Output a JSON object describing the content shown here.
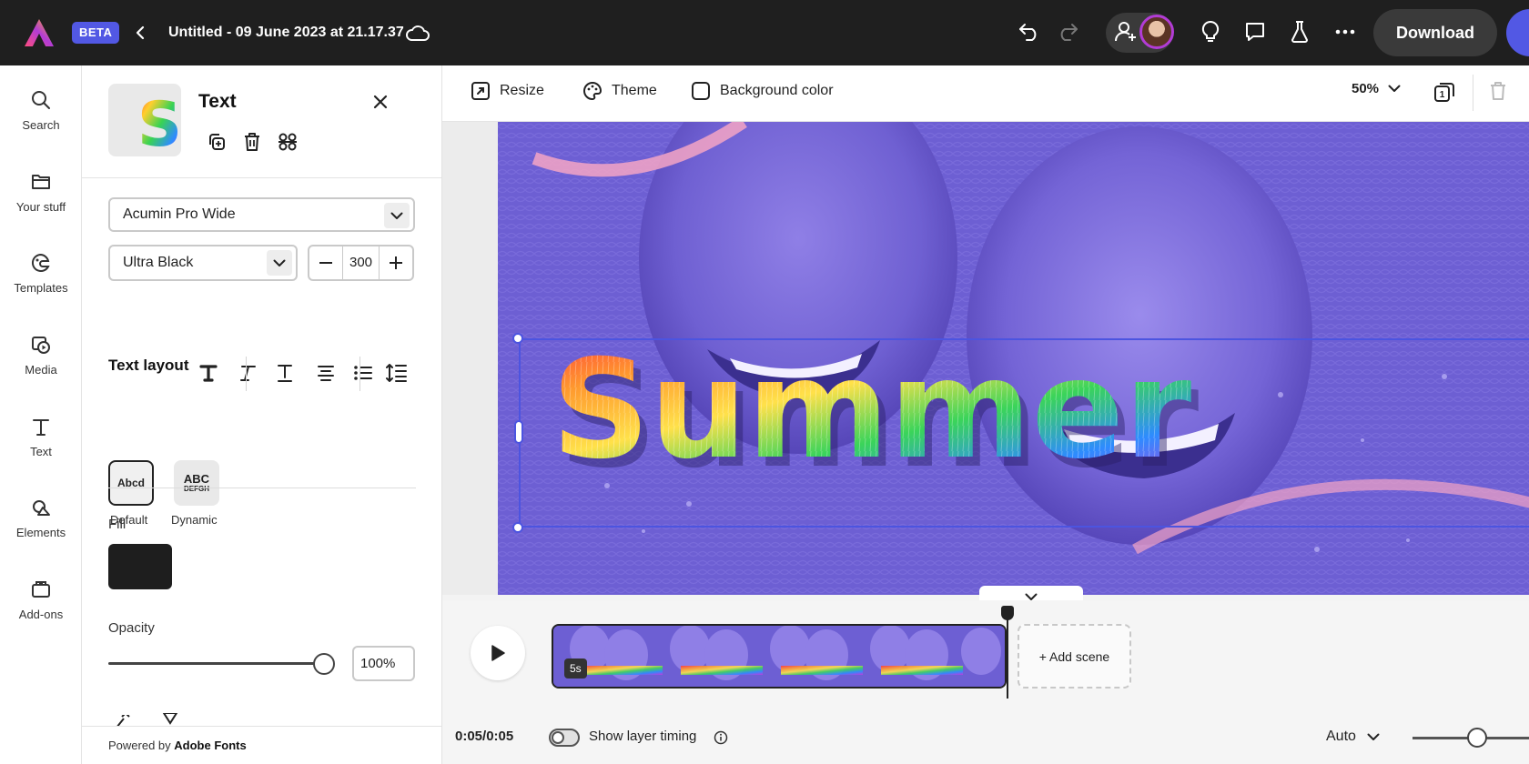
{
  "app": {
    "beta_badge": "BETA",
    "document_title": "Untitled - 09 June 2023 at 21.17.37",
    "download_label": "Download"
  },
  "rail": {
    "items": [
      {
        "label": "Search",
        "icon": "search-icon"
      },
      {
        "label": "Your stuff",
        "icon": "folder-icon"
      },
      {
        "label": "Templates",
        "icon": "templates-icon"
      },
      {
        "label": "Media",
        "icon": "media-icon"
      },
      {
        "label": "Text",
        "icon": "text-icon"
      },
      {
        "label": "Elements",
        "icon": "elements-icon"
      },
      {
        "label": "Add-ons",
        "icon": "addons-icon"
      }
    ]
  },
  "panel": {
    "title": "Text",
    "font_family": "Acumin Pro Wide",
    "font_weight": "Ultra Black",
    "font_size": "300",
    "text_layout_heading": "Text layout",
    "layouts": [
      {
        "label": "Default",
        "preview": "Abcd",
        "selected": true
      },
      {
        "label": "Dynamic",
        "preview": "ABC",
        "preview_sub": "DEFGH",
        "selected": false
      }
    ],
    "fill_label": "Fill",
    "fill_color": "#1e1e1e",
    "opacity_label": "Opacity",
    "opacity_value": "100%",
    "powered_prefix": "Powered by",
    "powered_brand": "Adobe Fonts"
  },
  "canvas_toolbar": {
    "resize": "Resize",
    "theme": "Theme",
    "background_color": "Background color",
    "zoom": "50%",
    "page_count": "1"
  },
  "canvas": {
    "text_content": "Summer",
    "accent_color": "#4c54e0",
    "duotone_color": "#6d5fd3"
  },
  "timeline": {
    "scene_duration": "5s",
    "add_scene": "+ Add scene",
    "time": "0:05/0:05",
    "show_layer_timing": "Show layer timing",
    "auto": "Auto"
  }
}
